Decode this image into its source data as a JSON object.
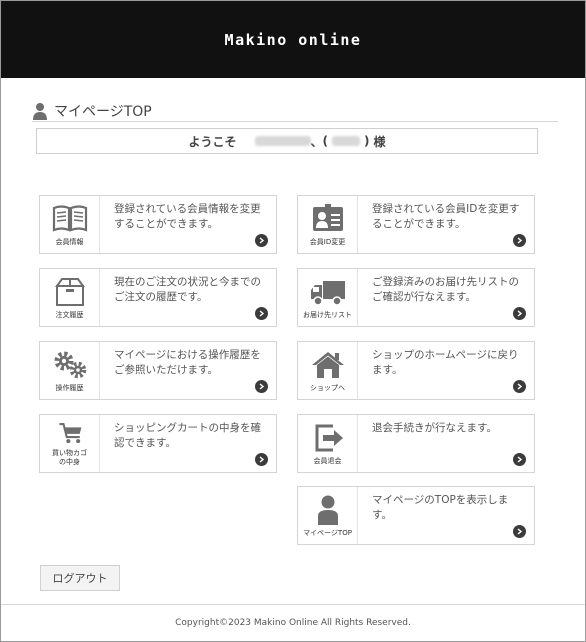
{
  "header": {
    "logo_text": "Makino online"
  },
  "page": {
    "title": "マイページTOP"
  },
  "welcome": {
    "prefix": "ようこそ",
    "comma": "、",
    "open_paren": "(",
    "close_paren": ")",
    "suffix": "様"
  },
  "cards": [
    {
      "label": "会員情報",
      "icon": "book-icon",
      "text": "登録されている会員情報を変更することができます。"
    },
    {
      "label": "会員ID変更",
      "icon": "id-card-icon",
      "text": "登録されている会員IDを変更することができます。"
    },
    {
      "label": "注文履歴",
      "icon": "box-icon",
      "text": "現在のご注文の状況と今までのご注文の履歴です。"
    },
    {
      "label": "お届け先リスト",
      "icon": "truck-icon",
      "text": "ご登録済みのお届け先リストのご確認が行なえます。"
    },
    {
      "label": "操作履歴",
      "icon": "gears-icon",
      "text": "マイページにおける操作履歴をご参照いただけます。"
    },
    {
      "label": "ショップへ",
      "icon": "home-icon",
      "text": "ショップのホームページに戻ります。"
    },
    {
      "label_line1": "買い物カゴ",
      "label_line2": "の中身",
      "icon": "cart-icon",
      "text": "ショッピングカートの中身を確認できます。"
    },
    {
      "label": "会員退会",
      "icon": "exit-icon",
      "text": "退会手続きが行なえます。"
    },
    {
      "label": "マイページTOP",
      "icon": "person-icon",
      "text": "マイページのTOPを表示します。"
    }
  ],
  "logout": {
    "label": "ログアウト"
  },
  "footer": {
    "copyright": "Copyright©2023 Makino Online All Rights Reserved."
  },
  "colors": {
    "header_bg": "#111111",
    "icon_gray": "#6e6e6e",
    "arrow": "#3b3b3b"
  }
}
